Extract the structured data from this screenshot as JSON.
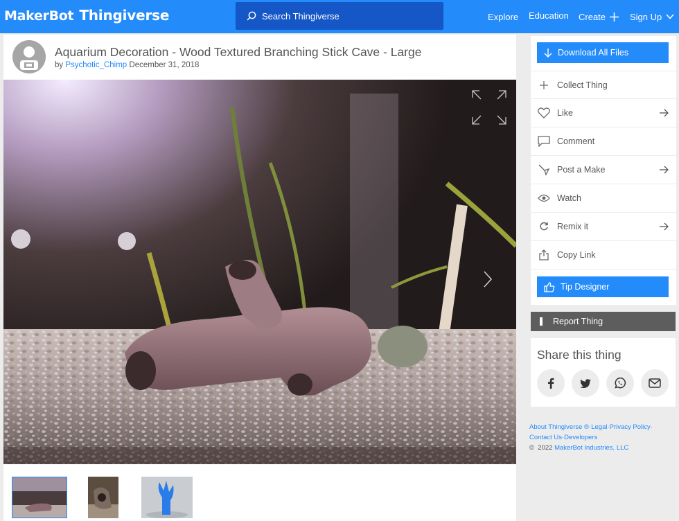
{
  "header": {
    "logo_part1": "MakerBot",
    "logo_part2": "Thingiverse",
    "search_placeholder": "Search Thingiverse",
    "nav": {
      "explore": "Explore",
      "education": "Education",
      "create": "Create",
      "signup": "Sign Up"
    }
  },
  "thing": {
    "title": "Aquarium Decoration - Wood Textured Branching Stick Cave - Large",
    "by": "by",
    "author": "Psychotic_Chimp",
    "date": "December 31, 2018"
  },
  "actions": {
    "download": "Download All Files",
    "collect": "Collect Thing",
    "like": "Like",
    "comment": "Comment",
    "post_make": "Post a Make",
    "watch": "Watch",
    "remix": "Remix it",
    "copy_link": "Copy Link",
    "tip": "Tip Designer",
    "report": "Report Thing"
  },
  "share": {
    "title": "Share this thing"
  },
  "footer": {
    "about": "About Thingiverse",
    "reg": "®",
    "sep": "·",
    "legal": "Legal",
    "privacy": "Privacy Policy",
    "contact": "Contact Us",
    "developers": "Developers",
    "copyright_symbol": "©",
    "year": "2022",
    "company": "MakerBot Industries, LLC"
  },
  "colors": {
    "brand_blue": "#248bfb",
    "search_bg": "#1557c6",
    "report_bg": "#5d5d5d",
    "page_bg": "#ececec"
  }
}
